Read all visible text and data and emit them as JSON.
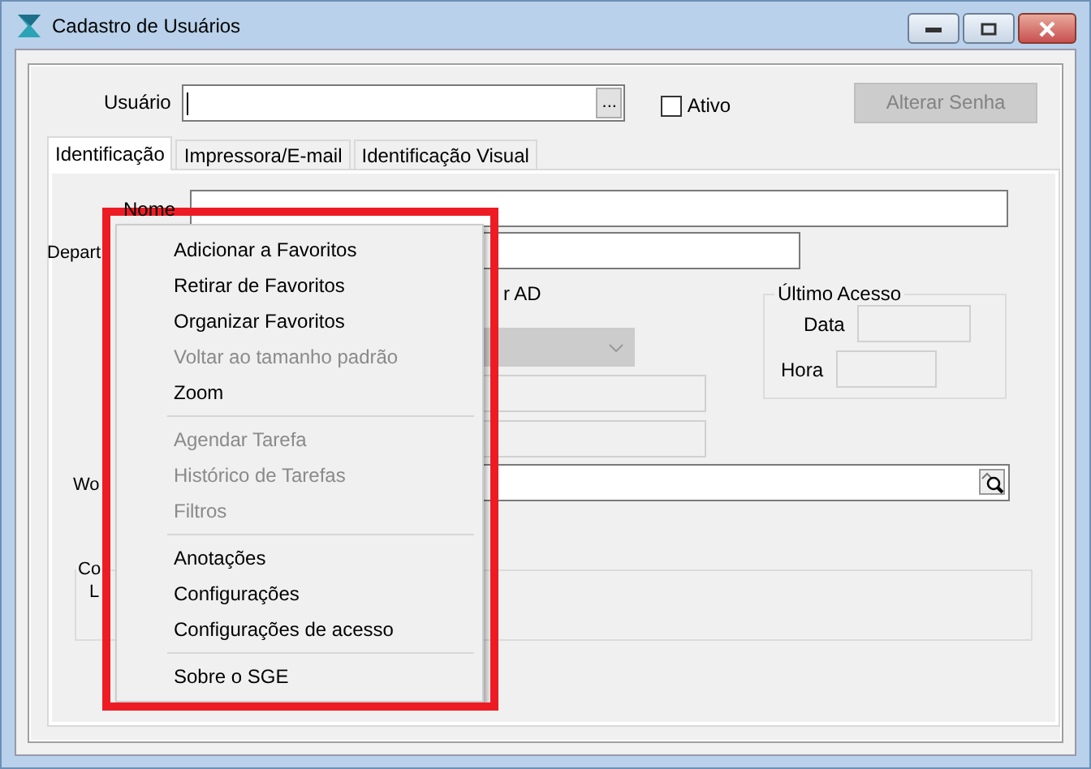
{
  "window": {
    "title": "Cadastro de Usuários"
  },
  "header": {
    "user_label": "Usuário",
    "browse_button": "...",
    "active_checkbox": {
      "label": "Ativo",
      "checked": false
    },
    "password_button": {
      "label": "Alterar Senha",
      "disabled": true
    }
  },
  "tabs": [
    {
      "label": "Identificação",
      "selected": true
    },
    {
      "label": "Impressora/E-mail",
      "selected": false
    },
    {
      "label": "Identificação Visual",
      "selected": false
    }
  ],
  "form": {
    "name_label": "Nome",
    "department_label": "Depart",
    "ad_label": "r AD",
    "ad_combo": {
      "disabled": true
    },
    "ad_fields": [
      {
        "disabled": true
      },
      {
        "disabled": true
      }
    ],
    "last_access": {
      "title": "Último Acesso",
      "date_label": "Data",
      "time_label": "Hora"
    },
    "work_label": "Wo",
    "group": {
      "title": "Co",
      "label": "L"
    }
  },
  "context_menu": {
    "items": [
      {
        "kind": "item",
        "label": "Adicionar a Favoritos",
        "disabled": false
      },
      {
        "kind": "item",
        "label": "Retirar de Favoritos",
        "disabled": false
      },
      {
        "kind": "item",
        "label": "Organizar Favoritos",
        "disabled": false
      },
      {
        "kind": "item",
        "label": "Voltar ao tamanho padrão",
        "disabled": true
      },
      {
        "kind": "item",
        "label": "Zoom",
        "disabled": false
      },
      {
        "kind": "separator"
      },
      {
        "kind": "item",
        "label": "Agendar Tarefa",
        "disabled": true
      },
      {
        "kind": "item",
        "label": "Histórico de Tarefas",
        "disabled": true
      },
      {
        "kind": "item",
        "label": "Filtros",
        "disabled": true
      },
      {
        "kind": "separator"
      },
      {
        "kind": "item",
        "label": "Anotações",
        "disabled": false
      },
      {
        "kind": "item",
        "label": "Configurações",
        "disabled": false
      },
      {
        "kind": "item",
        "label": "Configurações de acesso",
        "disabled": false
      },
      {
        "kind": "separator"
      },
      {
        "kind": "item",
        "label": "Sobre o SGE",
        "disabled": false
      }
    ]
  }
}
